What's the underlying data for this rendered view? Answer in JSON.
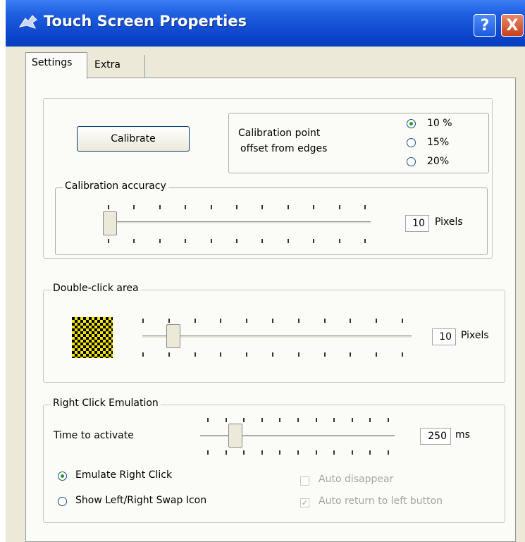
{
  "window": {
    "title": "Touch Screen Properties",
    "help_label": "?",
    "close_label": "X"
  },
  "tabs": [
    {
      "label": "Settings",
      "selected": true
    },
    {
      "label": "Extra",
      "selected": false
    }
  ],
  "calibration": {
    "button_label": "Calibrate",
    "offset_label_line1": "Calibration point",
    "offset_label_line2": "offset from edges",
    "offset_options": [
      {
        "label": "10 %",
        "selected": true
      },
      {
        "label": "15%",
        "selected": false
      },
      {
        "label": "20%",
        "selected": false
      }
    ],
    "accuracy": {
      "legend": "Calibration accuracy",
      "value": "10",
      "unit": "Pixels",
      "slider_position": 0
    }
  },
  "double_click": {
    "legend": "Double-click area",
    "value": "10",
    "unit": "Pixels",
    "slider_position": 0.11
  },
  "right_click": {
    "legend": "Right Click Emulation",
    "time_label": "Time to activate",
    "value": "250",
    "unit": "ms",
    "slider_position": 0.18,
    "mode_options": [
      {
        "label": "Emulate Right Click",
        "selected": true
      },
      {
        "label": "Show Left/Right Swap Icon",
        "selected": false
      }
    ],
    "auto_disappear_label": "Auto disappear",
    "auto_disappear_checked": false,
    "auto_return_label": "Auto return to left button",
    "auto_return_checked": true
  },
  "colors": {
    "titlebar": "#0a43c9",
    "dialog_bg": "#ece9d8",
    "panel_bg": "#fbfbf7"
  }
}
